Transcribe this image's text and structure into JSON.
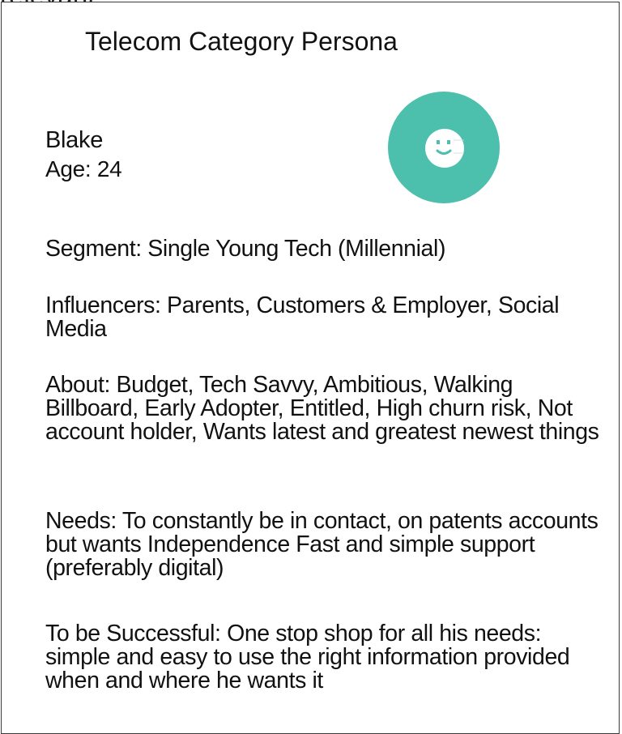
{
  "header_fragment": "relevant.",
  "persona": {
    "title": "Telecom Category Persona",
    "name": "Blake",
    "age": "Age: 24",
    "avatar_icon": "smiley-face-icon",
    "avatar_color": "#4dbfad"
  },
  "sections": {
    "segment": "Segment: Single Young Tech (Millennial)",
    "influencers": "Influencers: Parents, Customers & Employer, Social Media",
    "about": "About: Budget, Tech Savvy, Ambitious, Walking Billboard, Early Adopter, Entitled, High churn risk, Not account holder, Wants latest and greatest newest things",
    "needs": "Needs: To constantly be in contact, on patents  accounts but wants Independence Fast and  simple support (preferably digital)",
    "success": "To be Successful: One stop shop for all his needs: simple and easy to use the right information provided when and where he wants it"
  }
}
